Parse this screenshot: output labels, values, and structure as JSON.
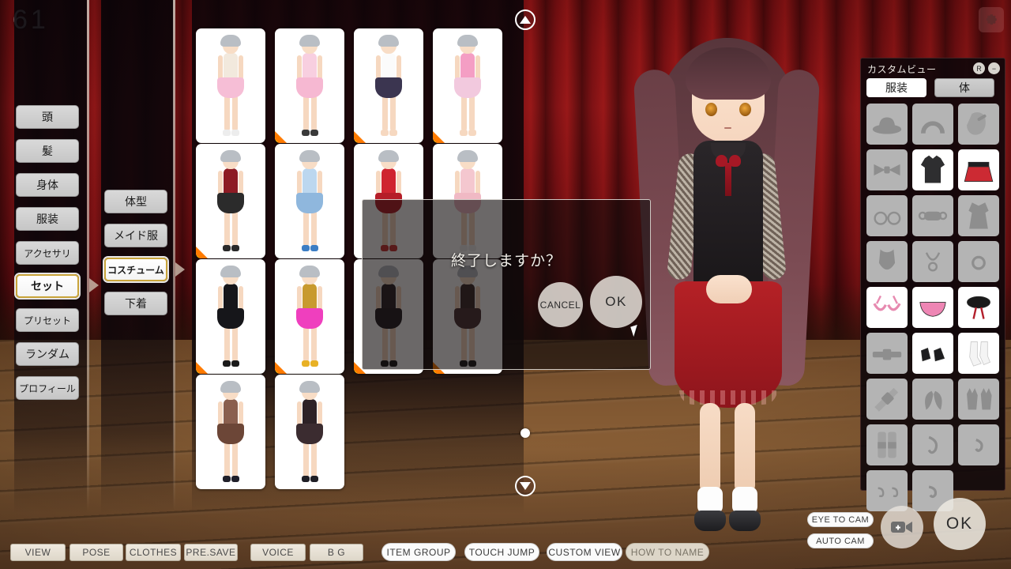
{
  "hud": {
    "fps": "61",
    "gear_icon": "gear-icon"
  },
  "left_menu": {
    "items": [
      {
        "label": "頭",
        "selected": false
      },
      {
        "label": "髪",
        "selected": false
      },
      {
        "label": "身体",
        "selected": false
      },
      {
        "label": "服装",
        "selected": false
      },
      {
        "label": "アクセサリ",
        "selected": false
      },
      {
        "label": "セット",
        "selected": true
      },
      {
        "label": "プリセット",
        "selected": false
      },
      {
        "label": "ランダム",
        "selected": false
      },
      {
        "label": "プロフィール",
        "selected": false
      }
    ]
  },
  "sub_menu": {
    "items": [
      {
        "label": "体型",
        "selected": false
      },
      {
        "label": "メイド服",
        "selected": false
      },
      {
        "label": "コスチューム",
        "selected": true
      },
      {
        "label": "下着",
        "selected": false
      }
    ]
  },
  "thumbnail_grid": {
    "columns": 4,
    "rows": 4,
    "scroll_up_icon": "triangle-up-icon",
    "scroll_down_icon": "triangle-down-icon",
    "items": [
      {
        "id": 1,
        "outfit": "pink frilled dress",
        "top": "#f2e9dd",
        "skirt": "#f6bed6",
        "shoes": "#ededed",
        "marked": false
      },
      {
        "id": 2,
        "outfit": "pink yukata",
        "top": "#f8cfe0",
        "skirt": "#f6b8d2",
        "shoes": "#3a3a3a",
        "marked": true
      },
      {
        "id": 3,
        "outfit": "white gym shirt",
        "top": "#fbfbfb",
        "skirt": "#3b3550",
        "shoes": "#f6d8c0",
        "marked": true
      },
      {
        "id": 4,
        "outfit": "pink bikini mini skirt",
        "top": "#f49ec4",
        "skirt": "#f2c9de",
        "shoes": "#f6d8c0",
        "marked": true
      },
      {
        "id": 5,
        "outfit": "black corset skirt",
        "top": "#8d1b24",
        "skirt": "#2b2b2b",
        "shoes": "#2a2a2a",
        "marked": true
      },
      {
        "id": 6,
        "outfit": "blue sailor uniform",
        "top": "#bcd7ef",
        "skirt": "#8fb7dd",
        "shoes": "#3c7ec4",
        "marked": false
      },
      {
        "id": 7,
        "outfit": "red china dress",
        "top": "#cf2430",
        "skirt": "#b51d28",
        "shoes": "#c33",
        "marked": false
      },
      {
        "id": 8,
        "outfit": "pink nurse outfit",
        "top": "#f4c7cf",
        "skirt": "#f0b9c4",
        "shoes": "#eee",
        "marked": false
      },
      {
        "id": 9,
        "outfit": "black bunny suit",
        "top": "#16161a",
        "skirt": "#16161a",
        "shoes": "#1a1a1a",
        "marked": true
      },
      {
        "id": 10,
        "outfit": "magenta dancer outfit",
        "top": "#c89a2e",
        "skirt": "#ef3fbe",
        "shoes": "#e8b125",
        "marked": true
      },
      {
        "id": 11,
        "outfit": "dark strap lingerie",
        "top": "#2a2428",
        "skirt": "#241f23",
        "shoes": "#181818",
        "marked": true
      },
      {
        "id": 12,
        "outfit": "dark corset dress",
        "top": "#3a2a2c",
        "skirt": "#4a3336",
        "shoes": "#1c1c1c",
        "marked": true
      },
      {
        "id": 13,
        "outfit": "brown harness bodysuit",
        "top": "#8a5f4e",
        "skirt": "#6c4637",
        "shoes": "#20202a",
        "marked": false
      },
      {
        "id": 14,
        "outfit": "black harness corset",
        "top": "#2d2226",
        "skirt": "#3b2c30",
        "shoes": "#1f1f26",
        "marked": false
      }
    ]
  },
  "dialog": {
    "message": "終了しますか？",
    "cancel_label": "CANCEL",
    "ok_label": "OK"
  },
  "custom_view": {
    "title": "カスタムビュー",
    "reset_icon": "R",
    "minimize_icon": "minimize-icon",
    "tabs": [
      {
        "label": "服装",
        "selected": true
      },
      {
        "label": "体",
        "selected": false
      }
    ],
    "slots": [
      {
        "icon": "hat-icon",
        "active": false
      },
      {
        "icon": "headband-icon",
        "active": false
      },
      {
        "icon": "hairpin-icon",
        "active": false
      },
      {
        "icon": "bowtie-icon",
        "active": false
      },
      {
        "icon": "top-icon",
        "active": true
      },
      {
        "icon": "skirt-icon",
        "active": true
      },
      {
        "icon": "glasses-icon",
        "active": false
      },
      {
        "icon": "eyemask-icon",
        "active": false
      },
      {
        "icon": "dress-icon",
        "active": false
      },
      {
        "icon": "swimsuit-icon",
        "active": false
      },
      {
        "icon": "necklace-icon",
        "active": false
      },
      {
        "icon": "choker-icon",
        "active": false
      },
      {
        "icon": "bra-icon",
        "active": true
      },
      {
        "icon": "panty-icon",
        "active": true
      },
      {
        "icon": "hairribbon-icon",
        "active": true
      },
      {
        "icon": "belt-icon",
        "active": false
      },
      {
        "icon": "shoes-icon",
        "active": true
      },
      {
        "icon": "socks-icon",
        "active": true
      },
      {
        "icon": "armband-icon",
        "active": false
      },
      {
        "icon": "wings-icon",
        "active": false
      },
      {
        "icon": "gloves-icon",
        "active": false
      },
      {
        "icon": "legbands-icon",
        "active": false
      },
      {
        "icon": "piercing-icon",
        "active": false
      },
      {
        "icon": "navel-ring-icon",
        "active": false
      },
      {
        "icon": "nipple-rings-icon",
        "active": false
      },
      {
        "icon": "ring-icon",
        "active": false
      }
    ]
  },
  "bottom_bar": {
    "buttons": [
      {
        "label": "VIEW"
      },
      {
        "label": "POSE"
      },
      {
        "label": "CLOTHES"
      },
      {
        "label": "PRE.SAVE"
      },
      {
        "label": "VOICE"
      },
      {
        "label": "B G"
      }
    ],
    "pills": [
      {
        "label": "ITEM GROUP",
        "muted": false
      },
      {
        "label": "TOUCH JUMP",
        "muted": false
      },
      {
        "label": "CUSTOM VIEW",
        "muted": false
      },
      {
        "label": "HOW TO NAME",
        "muted": true
      }
    ],
    "camera_pills": [
      {
        "label": "EYE TO CAM"
      },
      {
        "label": "AUTO CAM"
      }
    ],
    "camera_icon": "video-camera-add-icon",
    "ok_label": "OK"
  },
  "colors": {
    "accent_gold": "#c9a43a",
    "curtain_red": "#8d1417",
    "floor_brown": "#8a5f36",
    "marker_orange": "#ff7b00"
  }
}
